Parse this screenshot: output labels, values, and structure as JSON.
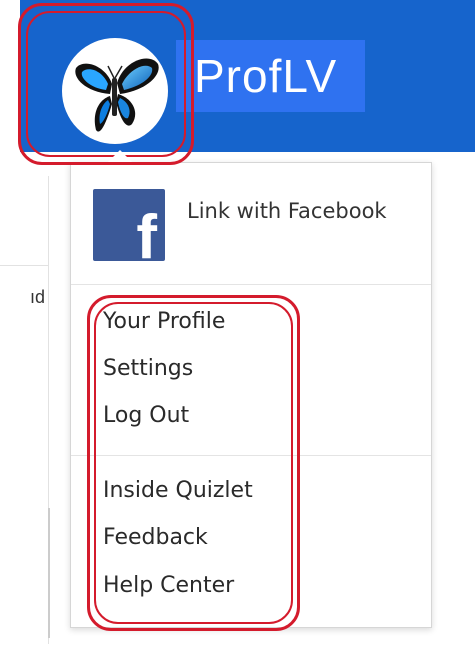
{
  "header": {
    "username": "ProfLV",
    "avatar_icon": "butterfly-icon",
    "bar_color": "#1664cc"
  },
  "page_background": {
    "snippet_text": "ıd"
  },
  "dropdown": {
    "facebook": {
      "icon": "facebook-icon",
      "logo_letter": "f",
      "label": "Link with Facebook",
      "brand_color": "#3b5998"
    },
    "group_one": [
      "Your Profile",
      "Settings",
      "Log Out"
    ],
    "group_two": [
      "Inside Quizlet",
      "Feedback",
      "Help Center"
    ]
  },
  "annotations": {
    "highlight_color": "#d41b2c"
  }
}
